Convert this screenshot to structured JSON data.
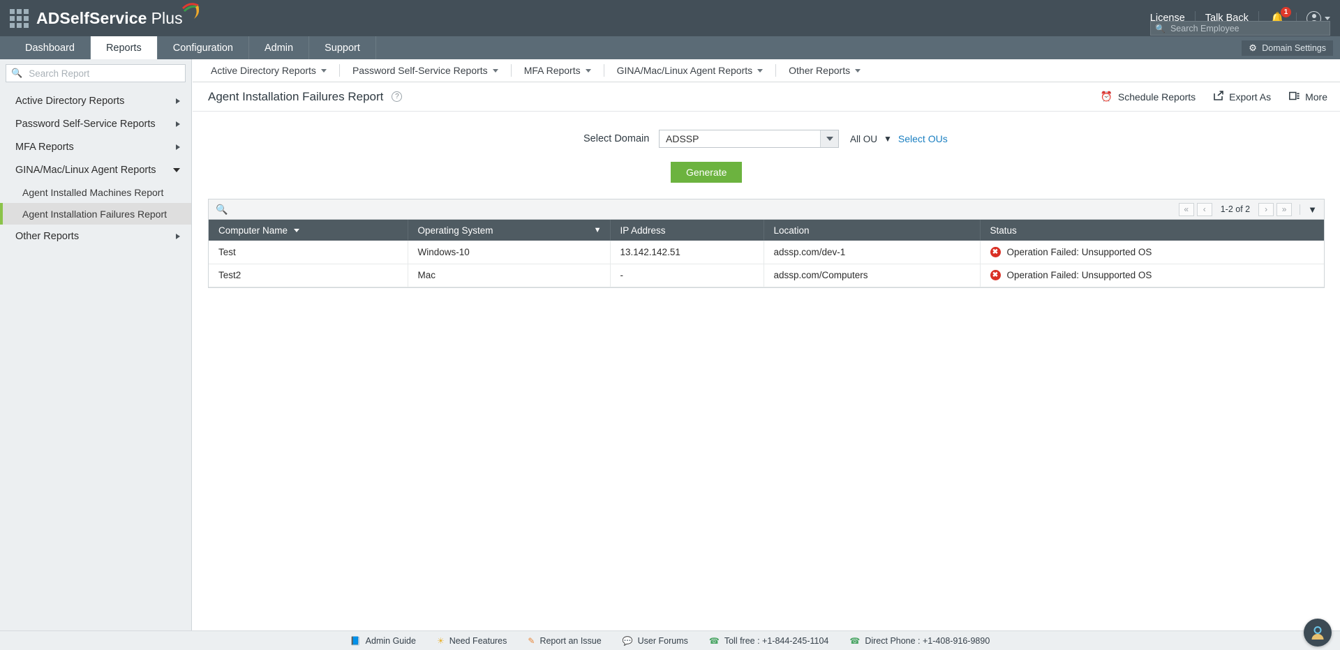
{
  "app": {
    "brand_bold": "ADSelfService",
    "brand_light": "Plus",
    "grid_icon": "app-grid-icon"
  },
  "header": {
    "license_label": "License",
    "talk_back_label": "Talk Back",
    "notification_count": "1",
    "bell_icon": "bell-icon",
    "user_icon": "user-avatar-icon",
    "employee_search": {
      "placeholder": "Search Employee",
      "value": "",
      "icon": "search-icon"
    }
  },
  "tabs": [
    {
      "label": "Dashboard",
      "active": false
    },
    {
      "label": "Reports",
      "active": true
    },
    {
      "label": "Configuration",
      "active": false
    },
    {
      "label": "Admin",
      "active": false
    },
    {
      "label": "Support",
      "active": false
    }
  ],
  "domain_settings": {
    "label": "Domain Settings",
    "icon": "gear-icon"
  },
  "sidebar": {
    "search": {
      "placeholder": "Search Report",
      "value": "",
      "icon": "search-icon"
    },
    "items": [
      {
        "label": "Active Directory Reports",
        "expanded": false
      },
      {
        "label": "Password Self-Service Reports",
        "expanded": false
      },
      {
        "label": "MFA Reports",
        "expanded": false
      },
      {
        "label": "GINA/Mac/Linux Agent Reports",
        "expanded": true
      },
      {
        "label": "Other Reports",
        "expanded": false
      }
    ],
    "sub_items": [
      {
        "label": "Agent Installed Machines Report",
        "active": false
      },
      {
        "label": "Agent Installation Failures Report",
        "active": true
      }
    ]
  },
  "subnav": [
    {
      "label": "Active Directory Reports"
    },
    {
      "label": "Password Self-Service Reports"
    },
    {
      "label": "MFA Reports"
    },
    {
      "label": "GINA/Mac/Linux Agent Reports"
    },
    {
      "label": "Other Reports"
    }
  ],
  "page": {
    "title": "Agent Installation Failures Report",
    "help_icon": "help-circle-icon",
    "actions": [
      {
        "label": "Schedule Reports",
        "icon": "alarm-clock-icon"
      },
      {
        "label": "Export As",
        "icon": "export-icon"
      },
      {
        "label": "More",
        "icon": "more-icon"
      }
    ]
  },
  "filters": {
    "domain_label": "Select Domain",
    "domain_value": "ADSSP",
    "ou_label": "All OU",
    "ou_filter_icon": "funnel-icon",
    "select_ous_link": "Select OUs",
    "generate_button": "Generate"
  },
  "table": {
    "toolbar": {
      "search_icon": "search-icon",
      "filter_icon": "funnel-icon",
      "pager": {
        "first": "«",
        "prev": "‹",
        "range": "1-2 of 2",
        "next": "›",
        "last": "»"
      }
    },
    "columns": [
      {
        "label": "Computer Name",
        "sort": "desc",
        "filter": false
      },
      {
        "label": "Operating System",
        "sort": null,
        "filter": true
      },
      {
        "label": "IP Address",
        "sort": null,
        "filter": false
      },
      {
        "label": "Location",
        "sort": null,
        "filter": false
      },
      {
        "label": "Status",
        "sort": null,
        "filter": false
      }
    ],
    "rows": [
      {
        "computer_name": "Test",
        "operating_system": "Windows-10",
        "ip_address": "13.142.142.51",
        "location": "adssp.com/dev-1",
        "status": "Operation Failed: Unsupported OS",
        "status_icon": "error-icon"
      },
      {
        "computer_name": "Test2",
        "operating_system": "Mac",
        "ip_address": "-",
        "location": "adssp.com/Computers",
        "status": "Operation Failed: Unsupported OS",
        "status_icon": "error-icon"
      }
    ]
  },
  "footer": {
    "items": [
      {
        "label": "Admin Guide",
        "icon": "book-icon",
        "color": "blue"
      },
      {
        "label": "Need Features",
        "icon": "lightbulb-icon",
        "color": "yellow"
      },
      {
        "label": "Report an Issue",
        "icon": "pencil-icon",
        "color": "orange"
      },
      {
        "label": "User Forums",
        "icon": "forum-icon",
        "color": "red"
      },
      {
        "label": "Toll free : +1-844-245-1104",
        "icon": "phone-icon",
        "color": "green"
      },
      {
        "label": "Direct Phone : +1-408-916-9890",
        "icon": "phone-icon",
        "color": "green"
      }
    ]
  },
  "chat": {
    "icon": "support-agent-icon"
  },
  "colors": {
    "header_bg": "#434F58",
    "tabbar_bg": "#5B6B76",
    "sidebar_bg": "#ECEFF1",
    "accent_green": "#6CB33F",
    "table_header_bg": "#4F5B62",
    "error_red": "#D93025",
    "link_blue": "#1A7FC1"
  }
}
